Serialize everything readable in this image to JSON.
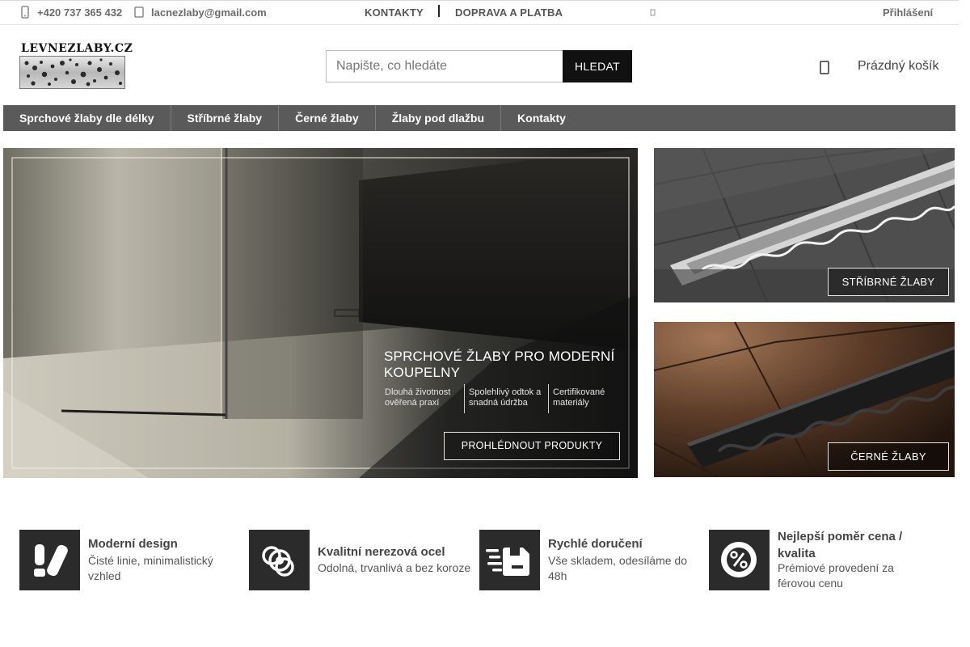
{
  "topbar": {
    "phone": "+420 737 365 432",
    "email": "lacnezlaby@gmail.com",
    "nav": [
      "KONTAKTY",
      "DOPRAVA A PLATBA"
    ],
    "login": "Přihlášení"
  },
  "header": {
    "logo_text": "LEVNEZLABY.CZ",
    "search_placeholder": "Napište, co hledáte",
    "search_button": "HLEDAT",
    "cart_label": "Prázdný košík"
  },
  "main_nav": [
    "Sprchové žlaby dle délky",
    "Stříbrné žlaby",
    "Černé žlaby",
    "Žlaby pod dlažbu",
    "Kontakty"
  ],
  "hero": {
    "title": "SPRCHOVÉ ŽLABY PRO MODERNÍ KOUPELNY",
    "features": [
      "Dlouhá životnost ověřená praxí",
      "Spolehlivý odtok a snadná údržba",
      "Certifikované materiály"
    ],
    "button": "PROHLÉDNOUT PRODUKTY"
  },
  "side_banners": [
    {
      "button": "STŘÍBRNÉ ŽLABY"
    },
    {
      "button": "ČERNÉ ŽLABY"
    }
  ],
  "features": [
    {
      "icon": "design-icon",
      "title": "Moderní design",
      "desc": "Čisté linie, minimalistický vzhled"
    },
    {
      "icon": "steel-rings-icon",
      "title": "Kvalitní nerezová ocel",
      "desc": "Odolná, trvanlivá a bez koroze"
    },
    {
      "icon": "delivery-icon",
      "title": "Rychlé doručení",
      "desc": "Vše skladem, odesíláme do 48h"
    },
    {
      "icon": "percent-badge-icon",
      "title": "Nejlepší poměr cena / kvalita",
      "desc": "Prémiové provedení za férovou cenu"
    }
  ],
  "colors": {
    "nav_bg": "#5a5a5a",
    "search_button_bg": "#111111",
    "feature_icon_bg": "#2b2b2b"
  }
}
